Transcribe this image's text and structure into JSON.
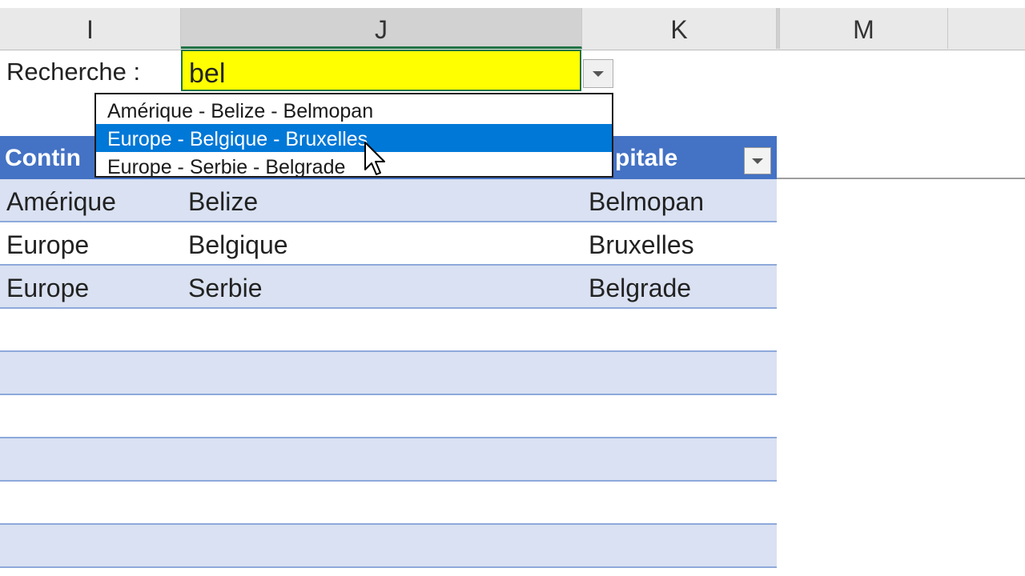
{
  "columns": [
    "I",
    "J",
    "K",
    "M"
  ],
  "active_column": "J",
  "search": {
    "label": "Recherche :",
    "value": "bel",
    "highlight_color": "#ffff00"
  },
  "dropdown": {
    "items": [
      "Amérique - Belize - Belmopan",
      "Europe - Belgique - Bruxelles",
      "Europe - Serbie - Belgrade"
    ],
    "selected_index": 1,
    "selected_color": "#0078d7"
  },
  "table": {
    "headers": [
      "Contin",
      "pitale"
    ],
    "header_color": "#4472c4",
    "band_color": "#d9e1f2",
    "rows": [
      [
        "Amérique",
        "Belize",
        "Belmopan"
      ],
      [
        "Europe",
        "Belgique",
        "Bruxelles"
      ],
      [
        "Europe",
        "Serbie",
        "Belgrade"
      ]
    ],
    "empty_rows": 6
  },
  "icons": {
    "dropdown_arrow": "chevron-down-icon",
    "filter": "filter-dropdown-icon",
    "cursor": "mouse-pointer-icon"
  }
}
